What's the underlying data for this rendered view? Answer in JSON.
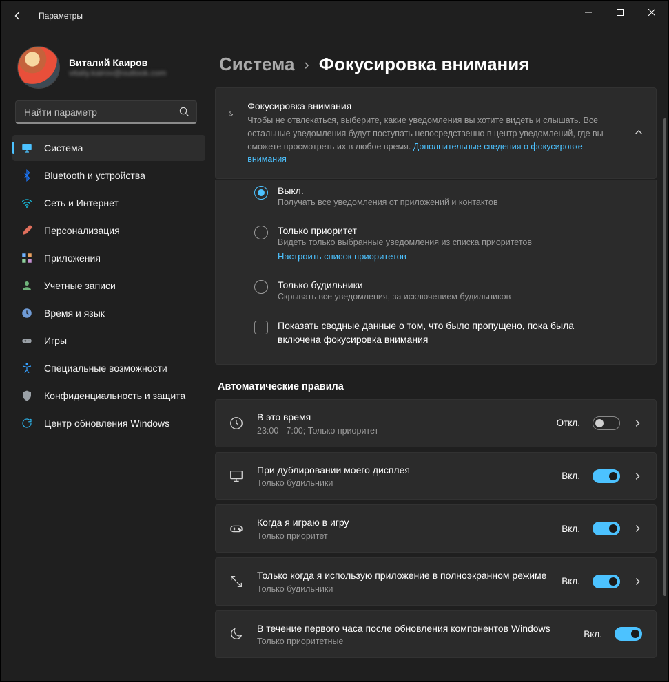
{
  "titlebar": {
    "app_title": "Параметры"
  },
  "user": {
    "name": "Виталий Каиров",
    "email": "vitaliy.kairov@outlook.com"
  },
  "search": {
    "placeholder": "Найти параметр"
  },
  "nav": [
    {
      "id": "system",
      "label": "Система",
      "icon_color": "#4cc2ff",
      "active": true
    },
    {
      "id": "bluetooth",
      "label": "Bluetooth и устройства",
      "icon_color": "#1a78ff"
    },
    {
      "id": "network",
      "label": "Сеть и Интернет",
      "icon_color": "#17c3e6"
    },
    {
      "id": "personalization",
      "label": "Персонализация",
      "icon_color": "#e06f5c"
    },
    {
      "id": "apps",
      "label": "Приложения",
      "icon_color": "#6fb2ff"
    },
    {
      "id": "accounts",
      "label": "Учетные записи",
      "icon_color": "#6fb37a"
    },
    {
      "id": "time",
      "label": "Время и язык",
      "icon_color": "#6f9bd6"
    },
    {
      "id": "gaming",
      "label": "Игры",
      "icon_color": "#9aa0a6"
    },
    {
      "id": "accessibility",
      "label": "Специальные возможности",
      "icon_color": "#35a0ff"
    },
    {
      "id": "privacy",
      "label": "Конфиденциальность и защита",
      "icon_color": "#9aa0a6"
    },
    {
      "id": "update",
      "label": "Центр обновления Windows",
      "icon_color": "#2cb1e8"
    }
  ],
  "breadcrumb": {
    "parent": "Система",
    "separator": "›",
    "current": "Фокусировка внимания"
  },
  "intro": {
    "title": "Фокусировка внимания",
    "desc_pre": "Чтобы не отвлекаться, выберите, какие уведомления вы хотите видеть и слышать. Все остальные уведомления будут поступать непосредственно в центр уведомлений, где вы сможете просмотреть их в любое время.  ",
    "link": "Дополнительные сведения о фокусировке внимания"
  },
  "modes": [
    {
      "id": "off",
      "title": "Выкл.",
      "sub": "Получать все уведомления от приложений и контактов",
      "checked": true
    },
    {
      "id": "priority",
      "title": "Только приоритет",
      "sub": "Видеть только выбранные уведомления из списка приоритетов",
      "link": "Настроить список приоритетов",
      "checked": false
    },
    {
      "id": "alarms",
      "title": "Только будильники",
      "sub": "Скрывать все уведомления, за исключением будильников",
      "checked": false
    }
  ],
  "summary_checkbox": {
    "label": "Показать сводные данные о том, что было пропущено, пока была включена фокусировка внимания",
    "checked": false
  },
  "rules_title": "Автоматические правила",
  "rules": [
    {
      "id": "hours",
      "icon": "clock",
      "title": "В это время",
      "sub": "23:00 - 7:00; Только приоритет",
      "state": "Откл.",
      "on": false,
      "chevron": true
    },
    {
      "id": "mirror",
      "icon": "monitor",
      "title": "При дублировании моего дисплея",
      "sub": "Только будильники",
      "state": "Вкл.",
      "on": true,
      "chevron": true
    },
    {
      "id": "game",
      "icon": "gamepad",
      "title": "Когда я играю в игру",
      "sub": "Только приоритет",
      "state": "Вкл.",
      "on": true,
      "chevron": true
    },
    {
      "id": "fullscreen",
      "icon": "expand",
      "title": "Только когда я использую приложение в полноэкранном режиме",
      "sub": "Только будильники",
      "state": "Вкл.",
      "on": true,
      "chevron": true
    },
    {
      "id": "postupdate",
      "icon": "moon",
      "title": "В течение первого часа после обновления компонентов Windows",
      "sub": "Только приоритетные",
      "state": "Вкл.",
      "on": true,
      "chevron": false
    }
  ]
}
